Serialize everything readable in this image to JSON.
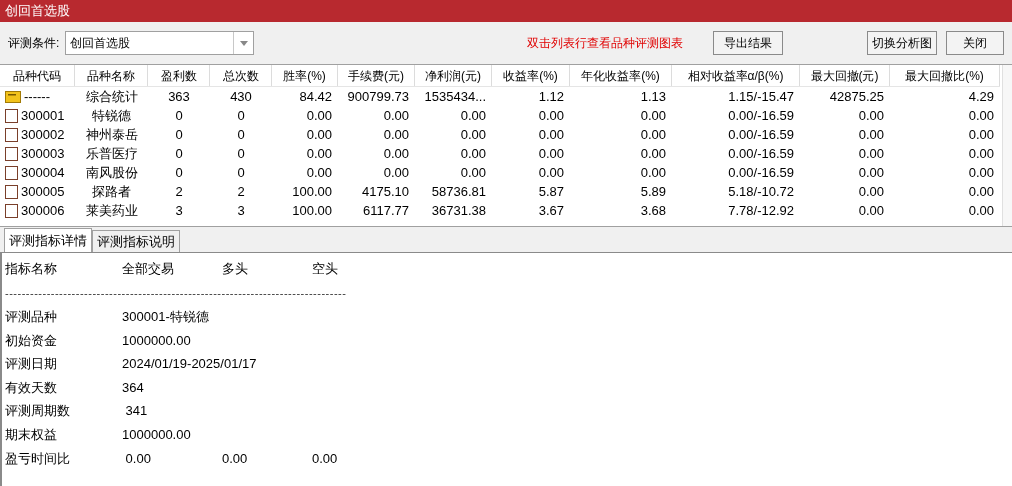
{
  "window": {
    "title": "创回首选股"
  },
  "toolbar": {
    "condition_label": "评测条件:",
    "condition_value": "创回首选股",
    "hint": "双击列表行查看品种评测图表",
    "buttons": [
      "导出结果",
      "切换分析图",
      "关闭"
    ]
  },
  "table": {
    "columns": [
      "品种代码",
      "品种名称",
      "盈利数",
      "总次数",
      "胜率(%)",
      "手续费(元)",
      "净利润(元)",
      "收益率(%)",
      "年化收益率(%)",
      "相对收益率α/β(%)",
      "最大回撤(元)",
      "最大回撤比(%)"
    ],
    "rows": [
      {
        "kind": "summary",
        "cells": [
          "------",
          "综合统计",
          "363",
          "430",
          "84.42",
          "900799.73",
          "1535434...",
          "1.12",
          "1.13",
          "1.15/-15.47",
          "42875.25",
          "4.29"
        ]
      },
      {
        "kind": "item",
        "cells": [
          "300001",
          "特锐德",
          "0",
          "0",
          "0.00",
          "0.00",
          "0.00",
          "0.00",
          "0.00",
          "0.00/-16.59",
          "0.00",
          "0.00"
        ]
      },
      {
        "kind": "item",
        "cells": [
          "300002",
          "神州泰岳",
          "0",
          "0",
          "0.00",
          "0.00",
          "0.00",
          "0.00",
          "0.00",
          "0.00/-16.59",
          "0.00",
          "0.00"
        ]
      },
      {
        "kind": "item",
        "cells": [
          "300003",
          "乐普医疗",
          "0",
          "0",
          "0.00",
          "0.00",
          "0.00",
          "0.00",
          "0.00",
          "0.00/-16.59",
          "0.00",
          "0.00"
        ]
      },
      {
        "kind": "item",
        "cells": [
          "300004",
          "南风股份",
          "0",
          "0",
          "0.00",
          "0.00",
          "0.00",
          "0.00",
          "0.00",
          "0.00/-16.59",
          "0.00",
          "0.00"
        ]
      },
      {
        "kind": "item",
        "cells": [
          "300005",
          "探路者",
          "2",
          "2",
          "100.00",
          "4175.10",
          "58736.81",
          "5.87",
          "5.89",
          "5.18/-10.72",
          "0.00",
          "0.00"
        ]
      },
      {
        "kind": "item",
        "cells": [
          "300006",
          "莱美药业",
          "3",
          "3",
          "100.00",
          "6117.77",
          "36731.38",
          "3.67",
          "3.68",
          "7.78/-12.92",
          "0.00",
          "0.00"
        ]
      }
    ]
  },
  "tabs": [
    {
      "label": "评测指标详情",
      "selected": true
    },
    {
      "label": "评测指标说明",
      "selected": false
    }
  ],
  "details": {
    "header": [
      "指标名称",
      "全部交易",
      "多头",
      "空头"
    ],
    "separator": "----------------------------------------------------------------------------------",
    "rows": [
      {
        "cells": [
          "评测品种",
          "300001-特锐德"
        ]
      },
      {
        "cells": [
          "初始资金",
          "1000000.00"
        ]
      },
      {
        "cells": [
          "评测日期",
          "2024/01/19-2025/01/17"
        ]
      },
      {
        "cells": [
          "有效天数",
          "364"
        ]
      },
      {
        "cells": [
          "评测周期数",
          " 341"
        ]
      },
      {
        "cells": [
          "期末权益",
          "1000000.00"
        ]
      },
      {
        "cells": [
          "盈亏时间比",
          " 0.00",
          "0.00",
          "0.00"
        ]
      }
    ]
  }
}
